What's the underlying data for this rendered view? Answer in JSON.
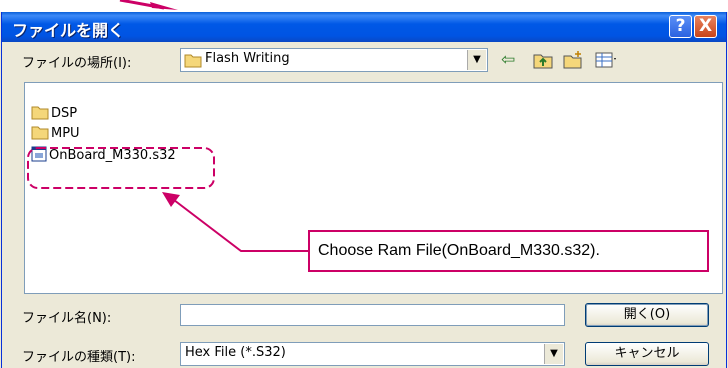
{
  "dialog": {
    "title": "ファイルを開く",
    "help_label": "?",
    "close_label": "X"
  },
  "lookin": {
    "label": "ファイルの場所(I):",
    "value": "Flash Writing"
  },
  "toolbar_icons": [
    "back-arrow-icon",
    "up-folder-icon",
    "new-folder-icon",
    "view-menu-icon"
  ],
  "files": [
    {
      "name": "DSP",
      "icon": "folder-icon"
    },
    {
      "name": "MPU",
      "icon": "folder-icon"
    },
    {
      "name": "OnBoard_M330.s32",
      "icon": "file-icon"
    }
  ],
  "filename": {
    "label": "ファイル名(N):",
    "value": ""
  },
  "filetype": {
    "label": "ファイルの種類(T):",
    "value": "Hex File (*.S32)"
  },
  "buttons": {
    "open": "開く(O)",
    "cancel": "キャンセル"
  },
  "annotation": {
    "text": "Choose Ram File(OnBoard_M330.s32).",
    "color": "#cc0066"
  },
  "colors": {
    "titlebar": "#0054e3",
    "dialog_bg": "#ece9d8",
    "folder": "#f5d77a"
  }
}
